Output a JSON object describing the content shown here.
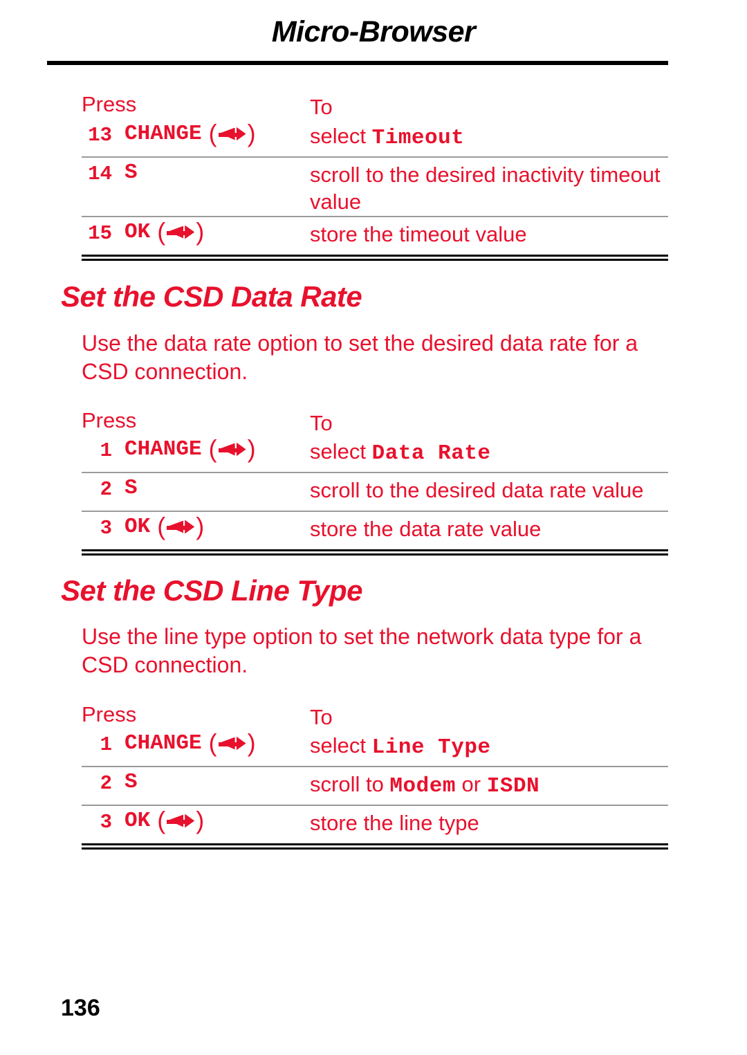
{
  "header": {
    "title": "Micro-Browser"
  },
  "table_headers": {
    "press": "Press",
    "to": "To"
  },
  "icons": {
    "softkey": "softkey-arrow-icon"
  },
  "block1": {
    "rows": [
      {
        "num": "13",
        "key": "CHANGE",
        "has_icon": true,
        "to_prefix": "select ",
        "to_mono": "Timeout",
        "to_suffix": ""
      },
      {
        "num": "14",
        "key": "S",
        "has_icon": false,
        "to_prefix": "scroll to the desired inactivity timeout value",
        "to_mono": "",
        "to_suffix": ""
      },
      {
        "num": "15",
        "key": "OK",
        "has_icon": true,
        "to_prefix": "store the timeout value",
        "to_mono": "",
        "to_suffix": ""
      }
    ]
  },
  "section2": {
    "heading": "Set the CSD Data Rate",
    "paragraph": "Use the data rate option to set the desired data rate for a CSD connection.",
    "rows": [
      {
        "num": "1",
        "key": "CHANGE",
        "has_icon": true,
        "to_prefix": "select ",
        "to_mono": "Data Rate",
        "to_suffix": ""
      },
      {
        "num": "2",
        "key": "S",
        "has_icon": false,
        "to_prefix": "scroll to the desired data rate value",
        "to_mono": "",
        "to_suffix": ""
      },
      {
        "num": "3",
        "key": "OK",
        "has_icon": true,
        "to_prefix": "store the data rate value",
        "to_mono": "",
        "to_suffix": ""
      }
    ]
  },
  "section3": {
    "heading": "Set the CSD Line Type",
    "paragraph": "Use the line type option to set the network data type for a CSD connection.",
    "rows": [
      {
        "num": "1",
        "key": "CHANGE",
        "has_icon": true,
        "to_prefix": "select ",
        "to_mono": "Line Type",
        "to_suffix": ""
      },
      {
        "num": "2",
        "key": "S",
        "has_icon": false,
        "to_prefix": "scroll to ",
        "to_mono": "Modem",
        "to_suffix": " or ",
        "to_mono2": "ISDN"
      },
      {
        "num": "3",
        "key": "OK",
        "has_icon": true,
        "to_prefix": "store the line type",
        "to_mono": "",
        "to_suffix": ""
      }
    ]
  },
  "footer": {
    "page_number": "136"
  },
  "colors": {
    "accent_red": "#e8112d",
    "rule_gray": "#9a9a9a",
    "text_black": "#000000"
  }
}
